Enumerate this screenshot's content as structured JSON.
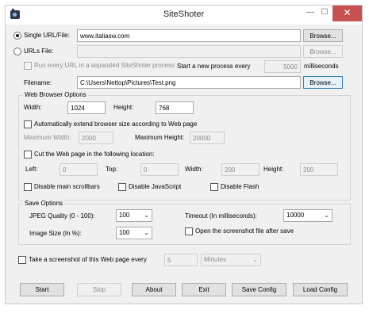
{
  "title": "SiteShoter",
  "window_controls": {
    "minimize": "—",
    "maximize": "☐",
    "close": "✕"
  },
  "single_url": {
    "label": "Single URL/File:",
    "value": "www.italiasw.com",
    "browse": "Browse..."
  },
  "urls_file": {
    "label": "URLs File:",
    "value": "",
    "browse": "Browse..."
  },
  "separate_process": {
    "label": "Run every URL in a separated SiteShoter process",
    "new_process_label": "Start a new process every",
    "value": "5000",
    "unit": "milliseconds"
  },
  "filename": {
    "label": "Filename:",
    "value": "C:\\Users\\Nettop\\Pictures\\Test.png",
    "browse": "Browse..."
  },
  "web_browser_options": {
    "group_label": "Web Browser Options",
    "width_label": "Width:",
    "width_value": "1024",
    "height_label": "Height:",
    "height_value": "768",
    "auto_extend_label": "Automatically extend browser size according to Web page",
    "max_width_label": "Maximum Width:",
    "max_width_value": "2000",
    "max_height_label": "Maximum Height:",
    "max_height_value": "20000",
    "cut_label": "Cut the Web page in the following location:",
    "left_label": "Left:",
    "left_value": "0",
    "top_label": "Top:",
    "top_value": "0",
    "cut_width_label": "Width:",
    "cut_width_value": "200",
    "cut_height_label": "Height:",
    "cut_height_value": "200",
    "disable_scrollbars": "Disable main scrollbars",
    "disable_javascript": "Disable JavaScript",
    "disable_flash": "Disable Flash"
  },
  "save_options": {
    "group_label": "Save Options",
    "jpeg_quality_label": "JPEG Quality (0 - 100):",
    "jpeg_quality_value": "100",
    "image_size_label": "Image Size (In %):",
    "image_size_value": "100",
    "timeout_label": "Timeout (In milliseconds):",
    "timeout_value": "10000",
    "open_after_save": "Open the screenshot file after save"
  },
  "periodic": {
    "label": "Take a screenshot of this Web page every",
    "value": "5",
    "unit": "Minutes"
  },
  "buttons": {
    "start": "Start",
    "stop": "Stop",
    "about": "About",
    "exit": "Exit",
    "save_config": "Save Config",
    "load_config": "Load Config"
  }
}
